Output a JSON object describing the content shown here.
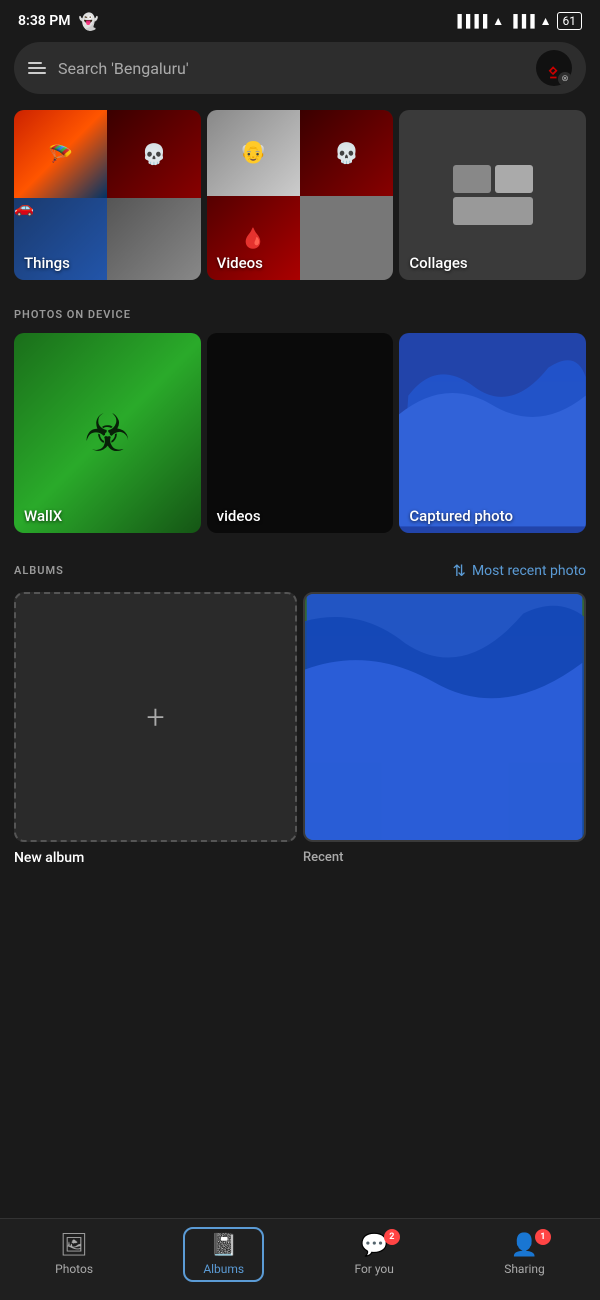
{
  "statusBar": {
    "time": "8:38 PM",
    "snapchatIcon": "👻",
    "batteryLevel": "61"
  },
  "searchBar": {
    "placeholder": "Search 'Bengaluru'"
  },
  "sections": {
    "things": {
      "label": "Things"
    },
    "videos": {
      "label": "Videos"
    },
    "collages": {
      "label": "Collages"
    }
  },
  "photosOnDevice": {
    "sectionHeader": "PHOTOS ON DEVICE",
    "items": [
      {
        "label": "WallX"
      },
      {
        "label": "videos"
      },
      {
        "label": "Captured photo"
      }
    ]
  },
  "albums": {
    "sectionHeader": "ALBUMS",
    "sortLabel": "Most recent photo",
    "newAlbumLabel": "New album",
    "addPlusSymbol": "+"
  },
  "bottomNav": {
    "items": [
      {
        "label": "Photos",
        "icon": "🖼",
        "badge": null,
        "active": false
      },
      {
        "label": "Albums",
        "icon": "📓",
        "badge": null,
        "active": true
      },
      {
        "label": "For you",
        "icon": "💬",
        "badge": "2",
        "active": false
      },
      {
        "label": "Sharing",
        "icon": "👤",
        "badge": "1",
        "active": false
      }
    ]
  }
}
